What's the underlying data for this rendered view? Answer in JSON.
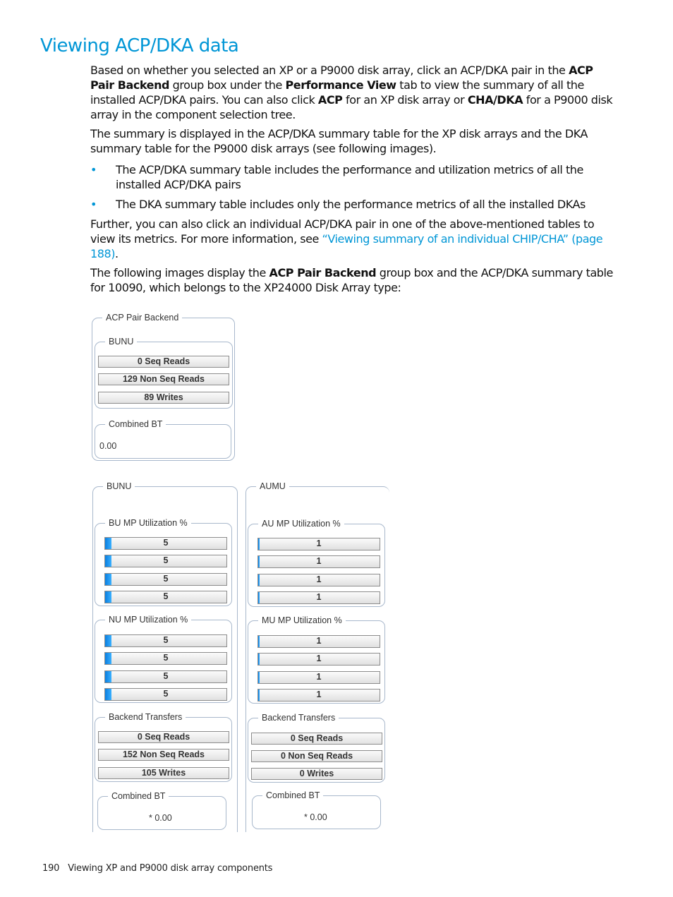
{
  "heading": "Viewing ACP/DKA data",
  "paragraphs": {
    "p1": {
      "t1": "Based on whether you selected an XP or a P9000 disk array, click an ACP/DKA pair in the ",
      "b1": "ACP Pair Backend",
      "t2": " group box under the ",
      "b2": "Performance View",
      "t3": " tab to view the summary of all the installed ACP/DKA pairs. You can also click ",
      "b3": "ACP",
      "t4": " for an XP disk array or ",
      "b4": "CHA/DKA",
      "t5": " for a P9000 disk array in the component selection tree."
    },
    "p2": "The summary is displayed in the ACP/DKA summary table for the XP disk arrays and the DKA summary table for the P9000 disk arrays (see following images).",
    "bullets": [
      "The ACP/DKA summary table includes the performance and utilization metrics of all the installed ACP/DKA pairs",
      "The DKA summary table includes only the performance metrics of all the installed DKAs"
    ],
    "p3": {
      "t1": "Further, you can also click an individual ACP/DKA pair in one of the above-mentioned tables to view its metrics. For more information, see ",
      "link": "“Viewing summary of an individual CHIP/CHA” (page 188)",
      "t2": "."
    },
    "p4": {
      "t1": "The following images display the ",
      "b1": "ACP Pair Backend",
      "t2": " group box and the ACP/DKA summary table for 10090, which belongs to the XP24000 Disk Array type:"
    }
  },
  "figure1": {
    "group_title": "ACP Pair Backend",
    "bunu": {
      "title": "BUNU",
      "fields": [
        "0 Seq Reads",
        "129 Non Seq Reads",
        "89 Writes"
      ]
    },
    "combined_bt": {
      "title": "Combined BT",
      "value": "0.00"
    }
  },
  "figure2": {
    "bunu": {
      "title": "BUNU",
      "bu_util": {
        "title": "BU MP Utilization %",
        "values": [
          5,
          5,
          5,
          5
        ]
      },
      "nu_util": {
        "title": "NU MP Utilization %",
        "values": [
          5,
          5,
          5,
          5
        ]
      },
      "backend": {
        "title": "Backend Transfers",
        "fields": [
          "0 Seq Reads",
          "152 Non Seq Reads",
          "105 Writes"
        ]
      },
      "combined_bt": {
        "title": "Combined BT",
        "value": "* 0.00"
      }
    },
    "aumu": {
      "title": "AUMU",
      "au_util": {
        "title": "AU MP Utilization %",
        "values": [
          1,
          1,
          1,
          1
        ]
      },
      "mu_util": {
        "title": "MU MP Utilization %",
        "values": [
          1,
          1,
          1,
          1
        ]
      },
      "backend": {
        "title": "Backend Transfers",
        "fields": [
          "0 Seq Reads",
          "0 Non Seq Reads",
          "0 Writes"
        ]
      },
      "combined_bt": {
        "title": "Combined BT",
        "value": "* 0.00"
      }
    }
  },
  "footer": {
    "page_number": "190",
    "section": "Viewing XP and P9000 disk array components"
  },
  "colors": {
    "accent": "#0096d6",
    "bar_fill": "#1a8fef"
  }
}
